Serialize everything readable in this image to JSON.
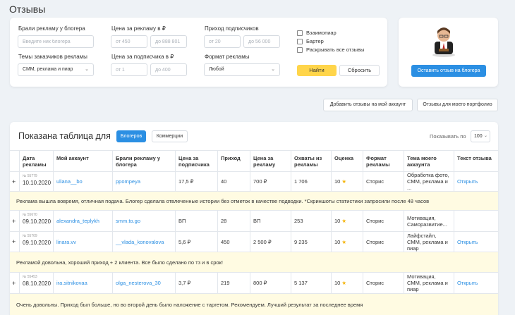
{
  "page_title": "Отзывы",
  "filters": {
    "took_ads_label": "Брали рекламу у блогера",
    "nick_placeholder": "Введите ник блогера",
    "price_label": "Цена за рекламу в ₽",
    "price_from": "от 450",
    "price_to": "до 888 801",
    "income_label": "Приход подписчиков",
    "income_from": "от 20",
    "income_to": "до 56 000",
    "topics_label": "Темы заказчиков рекламы",
    "topics_value": "СММ, реклама и пиар",
    "sub_price_label": "Цена за подписчика в ₽",
    "sub_from": "от 1",
    "sub_to": "до 400",
    "format_label": "Формат рекламы",
    "format_value": "Любой",
    "check_mutual": "Взаимопиар",
    "check_barter": "Бартер",
    "check_expand": "Раскрывать все отзывы",
    "find_label": "Найти",
    "reset_label": "Сбросить"
  },
  "promo": {
    "button_label": "Оставить отзыв на блогера"
  },
  "actions": {
    "add_reviews": "Добавить отзывы на мой аккаунт",
    "portfolio_reviews": "Отзывы для моего портфолио"
  },
  "table": {
    "title": "Показана таблица для",
    "tab_bloggers": "Блогеров",
    "tab_commercial": "Коммерции",
    "show_by_label": "Показывать по",
    "show_by_value": "100",
    "headers": [
      "Дата рекламы",
      "Мой аккаунт",
      "Брали рекламу у блогера",
      "Цена за подписчика",
      "Приход",
      "Цена за рекламу",
      "Охваты из рекламы",
      "Оценка",
      "Формат рекламы",
      "Тема моего аккаунта",
      "Текст отзыва"
    ],
    "rows": [
      {
        "id": "№ 55779",
        "date": "10.10.2020",
        "account": "uliana__bo",
        "blogger": "ppompeya",
        "sub_price": "17,5 ₽",
        "income": "40",
        "price": "700 ₽",
        "reach": "1 706",
        "rating": "10",
        "format": "Сторис",
        "topic": "Обработка фото, СММ, реклама и ...",
        "open": "Открыть",
        "note": "Реклама вышла вовремя, отличная подача. Блогер сделала отвлеченные истории без отметок в качестве подводки. *Скриншоты статистики запросили после 48 часов"
      },
      {
        "id": "№ 55670",
        "date": "09.10.2020",
        "account": "alexandra_teplykh",
        "blogger": "smm.to.go",
        "sub_price": "ВП",
        "income": "28",
        "price": "ВП",
        "reach": "253",
        "rating": "10",
        "format": "Сторис",
        "topic": "Мотивация, Саморазвитие...",
        "open": "",
        "note": ""
      },
      {
        "id": "№ 55709",
        "date": "09.10.2020",
        "account": "linara.vv",
        "blogger": "__vlada_konovalova",
        "sub_price": "5,6 ₽",
        "income": "450",
        "price": "2 500 ₽",
        "reach": "9 235",
        "rating": "10",
        "format": "Сторис",
        "topic": "Лайфстайл, СММ, реклама и пиар",
        "open": "Открыть",
        "note": "Рекламой довольна, хороший приход + 2 клиента. Все было сделано по тз и в срок!"
      },
      {
        "id": "№ 55453",
        "date": "08.10.2020",
        "account": "ira.sitnikovaa",
        "blogger": "olga_nesterova_30",
        "sub_price": "3,7 ₽",
        "income": "219",
        "price": "800 ₽",
        "reach": "5 137",
        "rating": "10",
        "format": "Сторис",
        "topic": "Мотивация, СММ, реклама и пиар",
        "open": "Открыть",
        "note": "Очень довольны. Приход был больше, но во второй день было наложение с таргетом. Рекомендуем. Лучший результат за последнее время"
      }
    ]
  }
}
